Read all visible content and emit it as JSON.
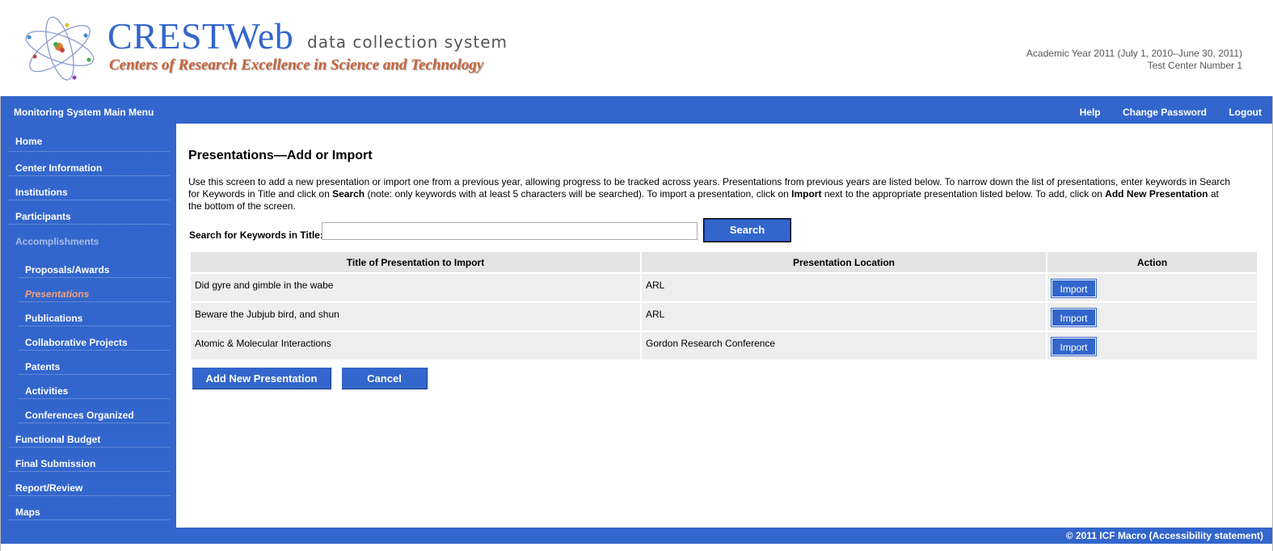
{
  "header": {
    "brand_title": "CRESTWeb",
    "brand_subtitle": "data collection system",
    "brand_tagline": "Centers of Research Excellence in Science and Technology",
    "academic_year": "Academic Year 2011 (July 1, 2010–June 30, 2011)",
    "center_name": "Test Center Number 1"
  },
  "topbar": {
    "title": "Monitoring System Main Menu",
    "links": [
      "Help",
      "Change Password",
      "Logout"
    ]
  },
  "sidebar": {
    "items": [
      {
        "label": "Home"
      },
      {
        "label": "Center Information"
      },
      {
        "label": "Institutions"
      },
      {
        "label": "Participants"
      },
      {
        "label": "Accomplishments"
      },
      {
        "label": "Proposals/Awards"
      },
      {
        "label": "Presentations"
      },
      {
        "label": "Publications"
      },
      {
        "label": "Collaborative Projects"
      },
      {
        "label": "Patents"
      },
      {
        "label": "Activities"
      },
      {
        "label": "Conferences Organized"
      },
      {
        "label": "Functional Budget"
      },
      {
        "label": "Final Submission"
      },
      {
        "label": "Report/Review"
      },
      {
        "label": "Maps"
      }
    ]
  },
  "main": {
    "title": "Presentations—Add or Import",
    "intro": {
      "p1": "Use this screen to add a new presentation or import one from a previous year, allowing progress to be tracked across years. Presentations from previous years are listed below. To narrow down the list of presentations, enter keywords in Search for Keywords in Title and click on ",
      "b1": "Search",
      "p2": " (note: only keywords with at least 5 characters will be searched). To import a presentation, click on ",
      "b2": "Import",
      "p3": " next to the appropriate presentation listed below. To add, click on ",
      "b3": "Add New Presentation",
      "p4": " at the bottom of the screen."
    },
    "search": {
      "label": "Search for Keywords in Title:",
      "value": "",
      "button": "Search"
    },
    "table": {
      "headers": [
        "Title of Presentation to Import",
        "Presentation Location",
        "Action"
      ],
      "rows": [
        {
          "title": "Did gyre and gimble in the wabe",
          "location": "ARL",
          "action": "Import"
        },
        {
          "title": "Beware the Jubjub bird, and shun",
          "location": "ARL",
          "action": "Import"
        },
        {
          "title": "Atomic & Molecular Interactions",
          "location": "Gordon Research Conference",
          "action": "Import"
        }
      ]
    },
    "buttons": {
      "add": "Add New Presentation",
      "cancel": "Cancel"
    }
  },
  "footer": {
    "text": "© 2011 ICF Macro (Accessibility statement)"
  },
  "colors": {
    "primary": "#3366cc",
    "accent": "#c8643c",
    "active_nav": "#f0a080"
  }
}
